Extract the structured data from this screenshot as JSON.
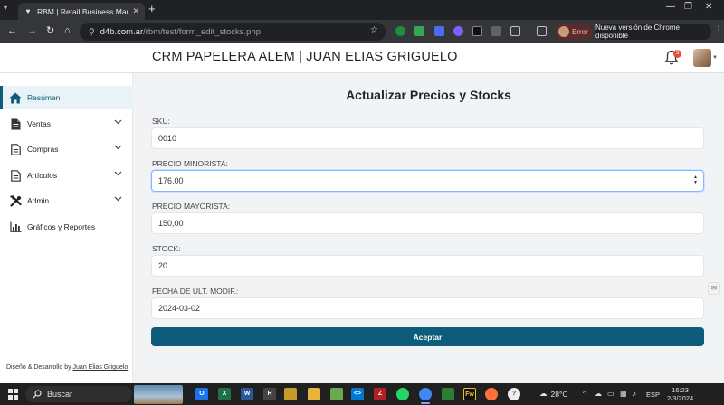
{
  "browser": {
    "tab_title": "RBM | Retail Business Managem",
    "url_host": "d4b.com.ar",
    "url_path": "/rbm/test/form_edit_stocks.php",
    "profile_status": "Error",
    "update_label": "Nueva versión de Chrome disponible"
  },
  "header": {
    "title": "CRM PAPELERA ALEM | JUAN ELIAS GRIGUELO",
    "notification_count": "3"
  },
  "sidebar": {
    "items": [
      {
        "label": "Resúmen"
      },
      {
        "label": "Ventas"
      },
      {
        "label": "Compras"
      },
      {
        "label": "Artículos"
      },
      {
        "label": "Admin"
      },
      {
        "label": "Gráficos y Reportes"
      }
    ],
    "footer_prefix": "Diseño & Desarrollo by ",
    "footer_author": "Juan Elias Griguelo"
  },
  "form": {
    "title": "Actualizar Precios y Stocks",
    "sku_label": "SKU:",
    "sku_value": "0010",
    "precio_minorista_label": "PRECIO MINORISTA:",
    "precio_minorista_value": "176,00",
    "precio_mayorista_label": "PRECIO MAYORISTA:",
    "precio_mayorista_value": "150,00",
    "stock_label": "STOCK:",
    "stock_value": "20",
    "fecha_label": "FECHA DE ULT. MODIF.:",
    "fecha_value": "2024-03-02",
    "submit_label": "Aceptar"
  },
  "taskbar": {
    "search_label": "Buscar",
    "temperature": "28°C",
    "language": "ESP",
    "time": "16:23",
    "date": "2/3/2024"
  },
  "colors": {
    "primary": "#0e5c7c",
    "sidebar_active_bg": "#e9f2f7",
    "badge": "#e74c3c"
  }
}
